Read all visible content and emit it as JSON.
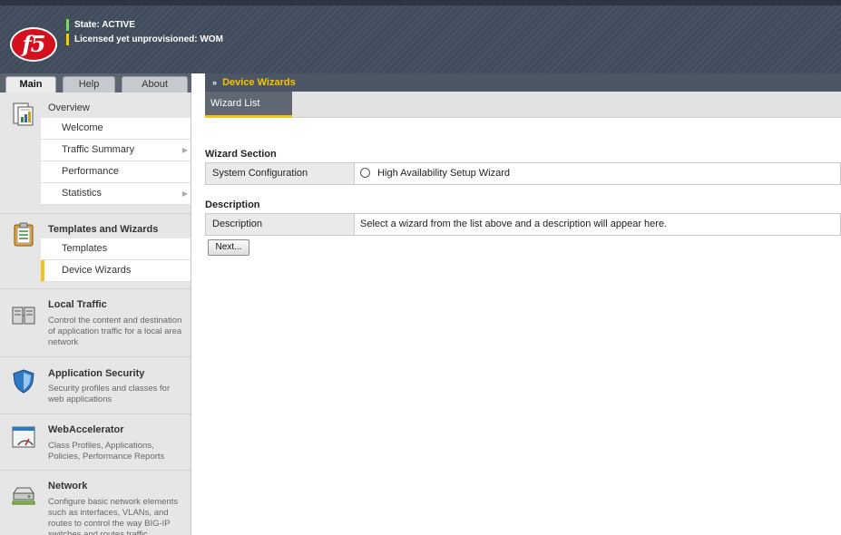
{
  "banner": {
    "logo": "f5",
    "status_lines": [
      {
        "text": "State: ACTIVE",
        "color": "#7ed957"
      },
      {
        "text": "Licensed yet unprovisioned: WOM",
        "color": "#f5d000"
      }
    ]
  },
  "left_tabs": [
    {
      "label": "Main",
      "active": true
    },
    {
      "label": "Help",
      "active": false
    },
    {
      "label": "About",
      "active": false
    }
  ],
  "sidebar": {
    "overview": {
      "title": "Overview",
      "icon": "overview-icon",
      "items": [
        {
          "label": "Welcome",
          "has_arrow": false
        },
        {
          "label": "Traffic Summary",
          "has_arrow": true
        },
        {
          "label": "Performance",
          "has_arrow": false
        },
        {
          "label": "Statistics",
          "has_arrow": true
        }
      ]
    },
    "templates": {
      "title": "Templates and Wizards",
      "icon": "clipboard-icon",
      "items": [
        {
          "label": "Templates",
          "selected": false
        },
        {
          "label": "Device Wizards",
          "selected": true
        }
      ]
    },
    "local_traffic": {
      "title": "Local Traffic",
      "icon": "servers-icon",
      "desc": "Control the content and destination of application traffic for a local area network"
    },
    "app_security": {
      "title": "Application Security",
      "icon": "shield-icon",
      "desc": "Security profiles and classes for web applications"
    },
    "web_accel": {
      "title": "WebAccelerator",
      "icon": "speedometer-icon",
      "desc": "Class Profiles, Applications, Policies, Performance Reports"
    },
    "network": {
      "title": "Network",
      "icon": "network-device-icon",
      "desc": "Configure basic network elements such as interfaces, VLANs, and routes to control the way BIG-IP switches and routes traffic"
    }
  },
  "main": {
    "header": "Device Wizards",
    "subtab": "Wizard List",
    "wizard_section": {
      "title": "Wizard Section",
      "row_label": "System Configuration",
      "option": "High Availability Setup Wizard"
    },
    "description": {
      "title": "Description",
      "row_label": "Description",
      "text": "Select a wizard from the list above and a description will appear here."
    },
    "next_button": "Next..."
  }
}
